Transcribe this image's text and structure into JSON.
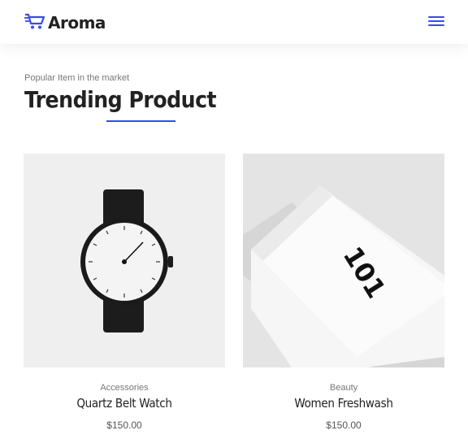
{
  "header": {
    "logo_text": "Aroma",
    "icons": {
      "logo": "cart-icon",
      "menu": "hamburger-menu-icon"
    },
    "accent_color": "#384aeb"
  },
  "section": {
    "subtitle": "Popular Item in the market",
    "title": "Trending Product"
  },
  "products": [
    {
      "category": "Accessories",
      "name": "Quartz Belt Watch",
      "price": "$150.00",
      "image": "watch-image"
    },
    {
      "category": "Beauty",
      "name": "Women Freshwash",
      "price": "$150.00",
      "image": "tube-image",
      "image_lettering": "101"
    }
  ]
}
